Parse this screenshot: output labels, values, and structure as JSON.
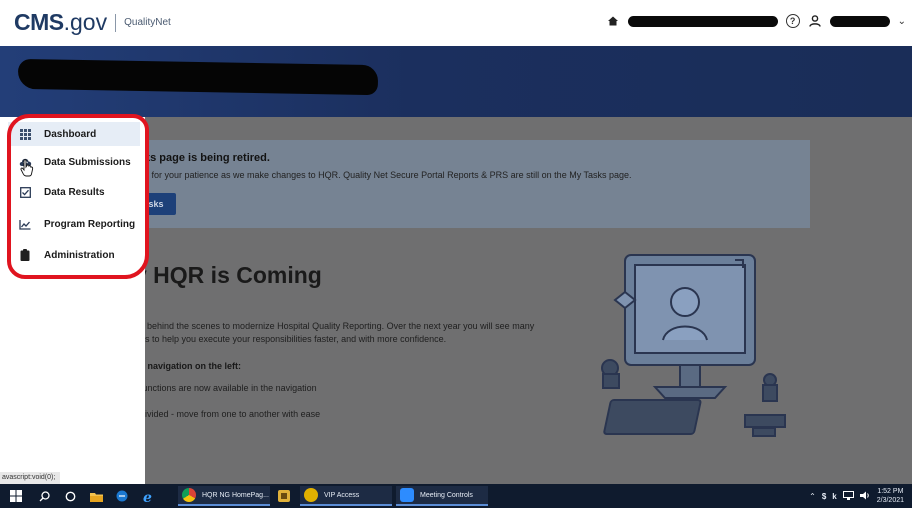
{
  "header": {
    "logo_cms": "CMS",
    "logo_gov": ".gov",
    "logo_product": "QualityNet",
    "help_icon": "help-circle-icon",
    "home_icon": "home-icon",
    "user_icon": "user-icon"
  },
  "sidebar": {
    "items": [
      {
        "label": "Dashboard",
        "icon": "grid-icon"
      },
      {
        "label": "Data Submissions",
        "icon": "cloud-upload-icon"
      },
      {
        "label": "Data Results",
        "icon": "checkbox-icon"
      },
      {
        "label": "Program Reporting",
        "icon": "chart-line-icon"
      },
      {
        "label": "Administration",
        "icon": "clipboard-icon"
      }
    ],
    "status_link": "avascript:void(0);"
  },
  "notice": {
    "title": "ks page is being retired.",
    "body": "u for your patience as we make changes to HQR. Quality Net Secure Portal Reports & PRS are still on the My Tasks page.",
    "button": "sks"
  },
  "content": {
    "headline": "v HQR is Coming",
    "para_line1": "k behind the scenes to modernize Hospital Quality Reporting. Over the next year you will see many",
    "para_line2": "es to help you execute your responsibilities faster, and with more confidence.",
    "nav_heading": "e navigation on the left:",
    "bullet1": "functions are now available in the navigation",
    "bullet2": "divided - move from one to another with ease"
  },
  "taskbar": {
    "apps": [
      {
        "label": "HQR NG HomePag...",
        "icon": "chrome-icon"
      },
      {
        "label": "VIP Access",
        "icon": "vip-access-icon"
      },
      {
        "label": "Meeting Controls",
        "icon": "zoom-icon"
      }
    ],
    "time": "1:52 PM",
    "date": "2/3/2021"
  },
  "colors": {
    "brand_navy": "#1f3a63",
    "banner": "#233e78",
    "highlight_red": "#e0141f"
  }
}
